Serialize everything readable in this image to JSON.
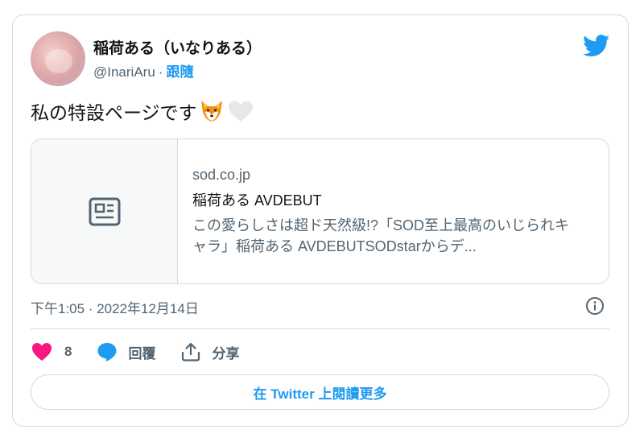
{
  "author": {
    "display_name": "稲荷ある（いなりある）",
    "handle": "@InariAru",
    "separator": "·",
    "follow_label": "跟隨"
  },
  "tweet": {
    "text": "私の特設ページです"
  },
  "link_card": {
    "domain": "sod.co.jp",
    "title": "稲荷ある AVDEBUT",
    "description": "この愛らしさは超ド天然級!?「SOD至上最高のいじられキャラ」稲荷ある AVDEBUTSODstarからデ..."
  },
  "meta": {
    "timestamp": "下午1:05 · 2022年12月14日"
  },
  "actions": {
    "like_count": "8",
    "reply_label": "回覆",
    "share_label": "分享"
  },
  "read_more_label": "在 Twitter 上閱讀更多",
  "colors": {
    "accent": "#1d9bf0",
    "like": "#f91880",
    "secondary_text": "#536471",
    "border": "#cfd9de"
  },
  "icons": {
    "platform": "twitter-bird-icon",
    "link_placeholder": "news-article-icon",
    "info": "info-icon",
    "like": "heart-icon",
    "reply": "speech-bubble-icon",
    "share": "share-upload-icon",
    "emoji_1": "fox-face-emoji",
    "emoji_2": "white-heart-emoji"
  }
}
